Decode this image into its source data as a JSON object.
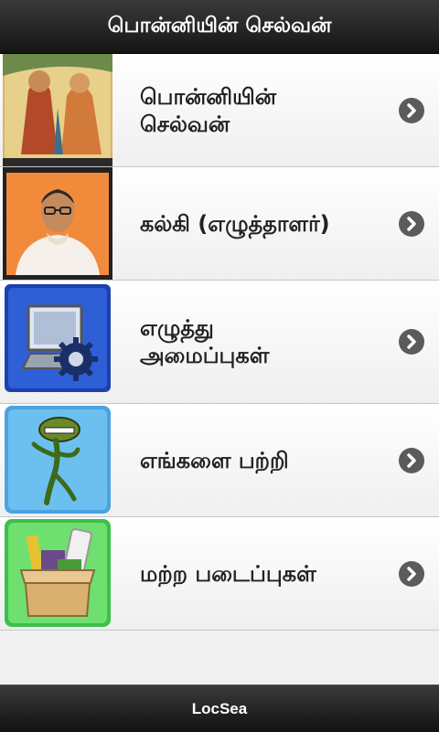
{
  "header": {
    "title": "பொன்னியின் செல்வன்"
  },
  "items": [
    {
      "label_line1": "பொன்னியின்",
      "label_line2": "செல்வன்",
      "thumb_icon": "painting-thumbnail"
    },
    {
      "label_line1": "கல்கி (எழுத்தாளர்)",
      "label_line2": "",
      "thumb_icon": "author-portrait-thumbnail"
    },
    {
      "label_line1": "எழுத்து",
      "label_line2": "அமைப்புகள்",
      "thumb_icon": "computer-settings-thumbnail"
    },
    {
      "label_line1": "எங்களை பற்றி",
      "label_line2": "",
      "thumb_icon": "character-thumbnail"
    },
    {
      "label_line1": "மற்ற படைப்புகள்",
      "label_line2": "",
      "thumb_icon": "box-thumbnail"
    }
  ],
  "footer": {
    "label": "LocSea"
  },
  "colors": {
    "header_bg": "#1f1f1f",
    "chevron": "#5b5b5b"
  }
}
